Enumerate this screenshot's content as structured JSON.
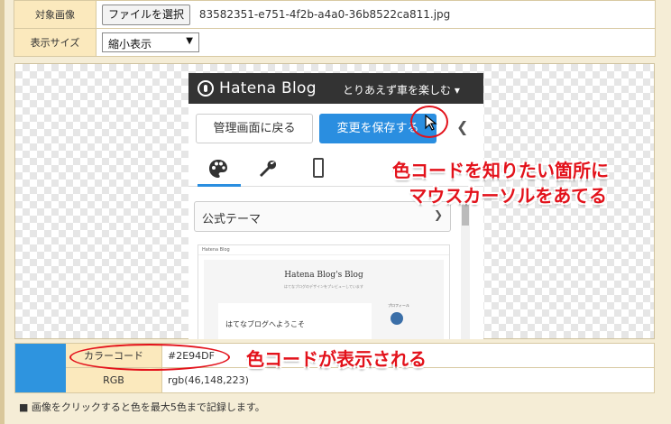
{
  "settings": {
    "target_label": "対象画像",
    "file_button": "ファイルを選択",
    "file_name": "83582351-e751-4f2b-a4a0-36b8522ca811.jpg",
    "size_label": "表示サイズ",
    "size_value": "縮小表示"
  },
  "preview": {
    "logo_text": "Hatena Blog",
    "blog_name": "とりあえず車を楽しむ ▾",
    "admin_button": "管理画面に戻る",
    "save_button": "変更を保存する",
    "theme_select": "公式テーマ",
    "mini_header": "Hatena Blog",
    "mini_title": "Hatena Blog's Blog",
    "mini_sub": "はてなブログのデザインをプレビューしています",
    "mini_post": "はてなブログへようこそ",
    "mini_profile": "プロフィール"
  },
  "annotations": {
    "callout1_line1": "色コードを知りたい箇所に",
    "callout1_line2": "マウスカーソルをあてる",
    "callout2": "色コードが表示される",
    "highlight_color": "#e3121b"
  },
  "result": {
    "color_code_label": "カラーコード",
    "color_code_value": "#2E94DF",
    "rgb_label": "RGB",
    "rgb_value": "rgb(46,148,223)",
    "swatch_color": "#2E94DF"
  },
  "note": "■ 画像をクリックすると色を最大5色まで記録します。"
}
